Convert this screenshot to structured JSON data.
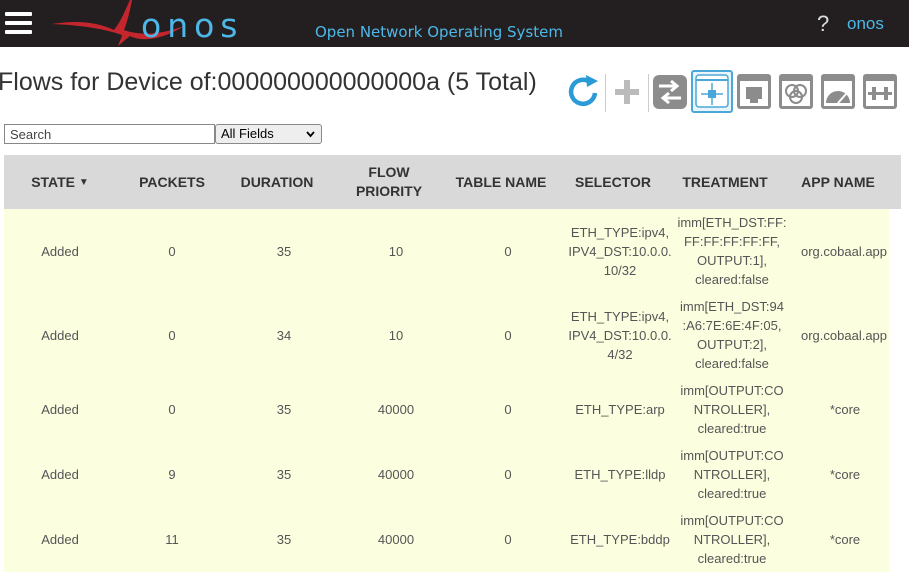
{
  "header": {
    "logo_text": "onos",
    "tagline": "Open Network Operating System",
    "help_label": "?",
    "user_label": "onos"
  },
  "page": {
    "title": "Flows for Device of:000000000000000a (5 Total)"
  },
  "toolbar": {
    "buttons": [
      {
        "name": "refresh-icon",
        "selected": false
      },
      {
        "name": "add-flow-icon",
        "selected": false
      },
      {
        "name": "switch-icon",
        "selected": false
      },
      {
        "name": "flows-icon",
        "selected": true
      },
      {
        "name": "ports-icon",
        "selected": false
      },
      {
        "name": "groups-icon",
        "selected": false
      },
      {
        "name": "meters-icon",
        "selected": false
      },
      {
        "name": "pipeconf-icon",
        "selected": false
      }
    ]
  },
  "search": {
    "placeholder": "Search",
    "field_selected": "All Fields"
  },
  "table": {
    "columns": [
      {
        "label": "STATE",
        "sort": "▼"
      },
      {
        "label": "PACKETS"
      },
      {
        "label": "DURATION"
      },
      {
        "label": "FLOW\nPRIORITY"
      },
      {
        "label": "TABLE NAME"
      },
      {
        "label": "SELECTOR"
      },
      {
        "label": "TREATMENT"
      },
      {
        "label": "APP NAME"
      }
    ],
    "rows": [
      {
        "state": "Added",
        "packets": "0",
        "duration": "35",
        "priority": "10",
        "table": "0",
        "selector": [
          "ETH_TYPE:ipv4,",
          "IPV4_DST:10.0.0.",
          "10/32"
        ],
        "treatment": [
          "imm[ETH_DST:FF:",
          "FF:FF:FF:FF:FF,",
          "OUTPUT:1],",
          "cleared:false"
        ],
        "app": "org.cobaal.app"
      },
      {
        "state": "Added",
        "packets": "0",
        "duration": "34",
        "priority": "10",
        "table": "0",
        "selector": [
          "ETH_TYPE:ipv4,",
          "IPV4_DST:10.0.0.",
          "4/32"
        ],
        "treatment": [
          "imm[ETH_DST:94",
          ":A6:7E:6E:4F:05,",
          "OUTPUT:2],",
          "cleared:false"
        ],
        "app": "org.cobaal.app"
      },
      {
        "state": "Added",
        "packets": "0",
        "duration": "35",
        "priority": "40000",
        "table": "0",
        "selector": [
          "ETH_TYPE:arp"
        ],
        "treatment": [
          "imm[OUTPUT:CO",
          "NTROLLER],",
          "cleared:true"
        ],
        "app": "*core"
      },
      {
        "state": "Added",
        "packets": "9",
        "duration": "35",
        "priority": "40000",
        "table": "0",
        "selector": [
          "ETH_TYPE:lldp"
        ],
        "treatment": [
          "imm[OUTPUT:CO",
          "NTROLLER],",
          "cleared:true"
        ],
        "app": "*core"
      },
      {
        "state": "Added",
        "packets": "11",
        "duration": "35",
        "priority": "40000",
        "table": "0",
        "selector": [
          "ETH_TYPE:bddp"
        ],
        "treatment": [
          "imm[OUTPUT:CO",
          "NTROLLER],",
          "cleared:true"
        ],
        "app": "*core"
      }
    ]
  },
  "colors": {
    "accent": "#4db8e8",
    "logo_red": "#c4262e",
    "header_bg": "#231f20",
    "row_bg": "#fcfee0",
    "thead_bg": "#d9d9d9",
    "icon_gray": "#8c8c8c",
    "selected_blue": "#4ba7d9"
  }
}
